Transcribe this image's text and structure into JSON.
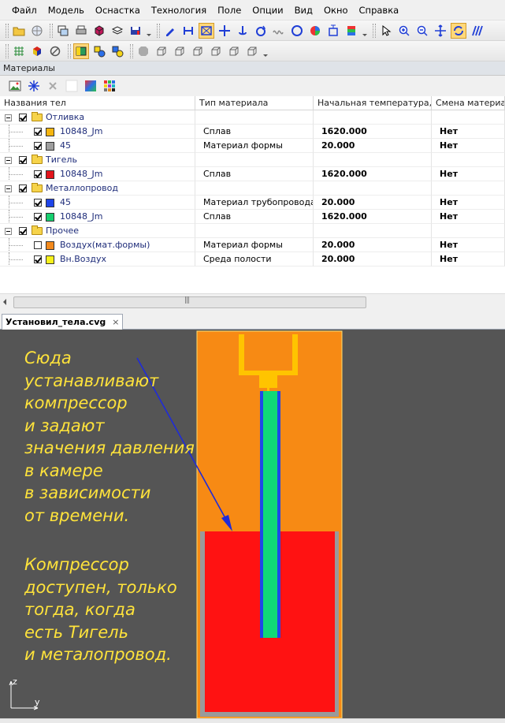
{
  "menu": [
    "Файл",
    "Модель",
    "Оснастка",
    "Технология",
    "Поле",
    "Опции",
    "Вид",
    "Окно",
    "Справка"
  ],
  "toolbar_icons_row1": [
    "open-folder",
    "globe",
    "copy-windows",
    "print",
    "cube-3d",
    "layers",
    "save-red",
    "pen-blue",
    "bracket-blue",
    "transform",
    "move-arrows",
    "anchor",
    "rotate-arrow",
    "wave",
    "circle",
    "color-wheel",
    "distribute",
    "stack-color",
    "cursor",
    "zoom-in",
    "zoom-out",
    "pan",
    "rotate-view",
    "stripes"
  ],
  "toolbar_icons_row2": [
    "grid-dots",
    "color-cube",
    "sphere-outline",
    "yellow-rect",
    "shapes",
    "shapes-yellow",
    "octagon",
    "cube-1",
    "cube-2",
    "cube-3",
    "cube-4",
    "cube-5",
    "cube-6"
  ],
  "panel": {
    "title": "Материалы",
    "tools": [
      "image-tool",
      "star-tool",
      "close-x",
      "blank",
      "gradient",
      "color-grid"
    ]
  },
  "grid": {
    "headers": [
      "Названия тел",
      "Тип материала",
      "Начальная температура, ...",
      "Смена материала"
    ],
    "rows": [
      {
        "level": 0,
        "name": "Отливка",
        "type": "",
        "temp": "",
        "change": "",
        "checked": true,
        "color": ""
      },
      {
        "level": 1,
        "name": "10848_Jm",
        "type": "Сплав",
        "temp": "1620.000",
        "change": "Нет",
        "checked": true,
        "color": "#f5b50f"
      },
      {
        "level": 1,
        "name": "45",
        "type": "Материал формы",
        "temp": "20.000",
        "change": "Нет",
        "checked": true,
        "color": "#9e9e9e"
      },
      {
        "level": 0,
        "name": "Тигель",
        "type": "",
        "temp": "",
        "change": "",
        "checked": true,
        "color": ""
      },
      {
        "level": 1,
        "name": "10848_Jm",
        "type": "Сплав",
        "temp": "1620.000",
        "change": "Нет",
        "checked": true,
        "color": "#e3141b"
      },
      {
        "level": 0,
        "name": "Металлопровод",
        "type": "",
        "temp": "",
        "change": "",
        "checked": true,
        "color": ""
      },
      {
        "level": 1,
        "name": "45",
        "type": "Материал трубопровода",
        "temp": "20.000",
        "change": "Нет",
        "checked": true,
        "color": "#1e44e8"
      },
      {
        "level": 1,
        "name": "10848_Jm",
        "type": "Сплав",
        "temp": "1620.000",
        "change": "Нет",
        "checked": true,
        "color": "#16cf6f"
      },
      {
        "level": 0,
        "name": "Прочее",
        "type": "",
        "temp": "",
        "change": "",
        "checked": true,
        "color": ""
      },
      {
        "level": 1,
        "name": "Воздух(мат.формы)",
        "type": "Материал формы",
        "temp": "20.000",
        "change": "Нет",
        "checked": false,
        "color": "#f2891c"
      },
      {
        "level": 1,
        "name": "Вн.Воздух",
        "type": "Среда полости",
        "temp": "20.000",
        "change": "Нет",
        "checked": true,
        "color": "#f7f11a"
      }
    ]
  },
  "document_tab": {
    "label": "Установил_тела.cvg",
    "close": "×"
  },
  "annotation": {
    "paragraph1": [
      "Сюда",
      "устанавливают",
      "компрессор",
      "и задают",
      "значения давления",
      "в камере",
      "в зависимости",
      "от времени."
    ],
    "paragraph2": [
      "Компрессор",
      "доступен, только",
      "тогда, когда",
      "есть Тигель",
      "и металопровод."
    ]
  },
  "axes": {
    "vertical": "z",
    "horizontal": "y"
  },
  "colors": {
    "viewport_bg": "#555555",
    "annotation_text": "#ffe33b",
    "mold": "#f78a14",
    "crucible": "#ff1212",
    "crucible_wall": "#9a9a9a",
    "pipe_inner": "#10d877",
    "pipe_wall": "#1f47e8",
    "casting": "#ffc400",
    "arrow": "#1f2bd8"
  }
}
